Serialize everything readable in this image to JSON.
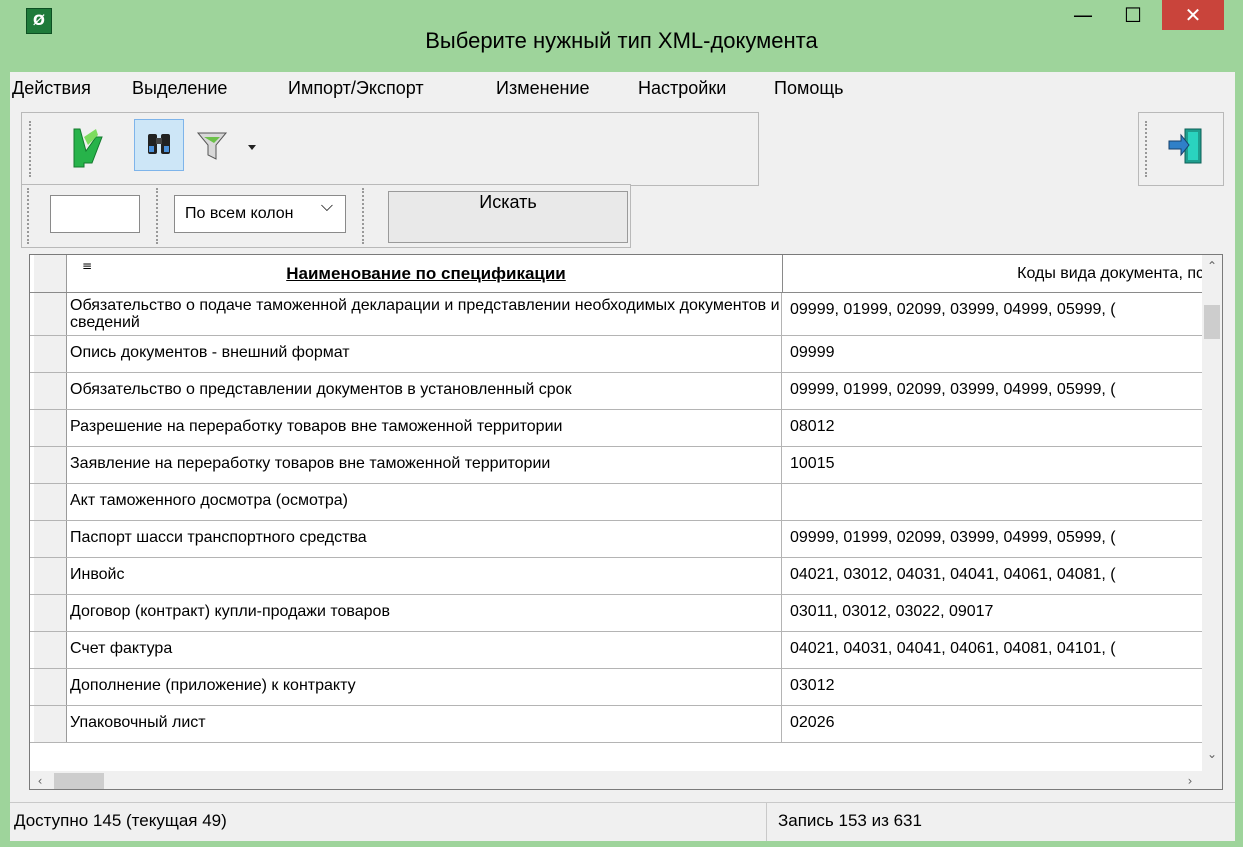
{
  "window": {
    "title": "Выберите нужный тип XML-документа"
  },
  "menu": [
    "Действия",
    "Выделение",
    "Импорт/Экспорт",
    "Изменение",
    "Настройки",
    "Помощь"
  ],
  "icons": {
    "app": "app-icon",
    "open": "green-arrow-icon",
    "find": "binoculars-icon",
    "filter": "filter-icon",
    "exit": "exit-door-icon"
  },
  "search": {
    "input_value": "",
    "scope_selected": "По всем колон",
    "search_button": "Искать"
  },
  "grid": {
    "columns": [
      "Наименование по спецификации",
      "Коды вида документа, пс"
    ],
    "rows": [
      {
        "name": "Обязательство о подаче таможенной декларации и представлении необходимых документов и сведений",
        "codes": "09999, 01999, 02099, 03999, 04999, 05999, ("
      },
      {
        "name": "Опись документов - внешний формат",
        "codes": "09999"
      },
      {
        "name": "Обязательство о представлении документов в установленный срок",
        "codes": "09999, 01999, 02099, 03999, 04999, 05999, ("
      },
      {
        "name": "Разрешение на переработку товаров вне таможенной территории",
        "codes": "08012"
      },
      {
        "name": "Заявление на переработку товаров вне таможенной территории",
        "codes": "10015"
      },
      {
        "name": "Акт таможенного досмотра (осмотра)",
        "codes": ""
      },
      {
        "name": "Паспорт шасси транспортного средства",
        "codes": "09999, 01999, 02099, 03999, 04999, 05999, ("
      },
      {
        "name": "Инвойс",
        "codes": "04021, 03012, 04031, 04041, 04061, 04081, ("
      },
      {
        "name": "Договор (контракт) купли-продажи товаров",
        "codes": "03011, 03012, 03022, 09017"
      },
      {
        "name": "Счет фактура",
        "codes": "04021, 04031, 04041, 04061, 04081, 04101, ("
      },
      {
        "name": "Дополнение (приложение) к контракту",
        "codes": "03012"
      },
      {
        "name": "Упаковочный лист",
        "codes": "02026"
      }
    ]
  },
  "status": {
    "left": "Доступно 145 (текущая 49)",
    "right": "Запись 153 из 631"
  },
  "colors": {
    "title_bg": "#9ed49b",
    "close_red": "#c9443b",
    "grid_bg": "#ffffff"
  }
}
